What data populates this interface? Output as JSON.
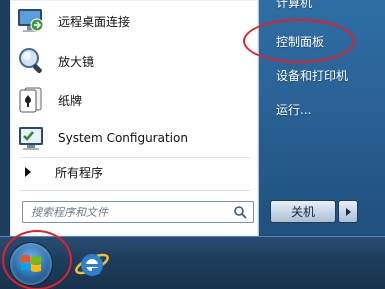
{
  "programs": {
    "remote_desktop": "远程桌面连接",
    "magnifier": "放大镜",
    "solitaire": "纸牌",
    "system_configuration": "System Configuration",
    "all_programs": "所有程序"
  },
  "search": {
    "placeholder": "搜索程序和文件"
  },
  "right_panel": {
    "computer": "计算机",
    "control_panel": "控制面板",
    "devices_printers": "设备和打印机",
    "run": "运行...",
    "shutdown": "关机"
  },
  "colors": {
    "annotation_red": "#e0202a",
    "right_panel_blue": "#2a6397"
  }
}
